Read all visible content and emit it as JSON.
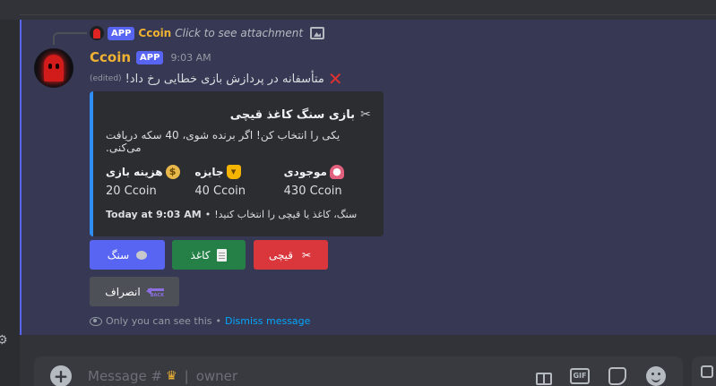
{
  "reply": {
    "app_badge": "APP",
    "username": "Ccoin",
    "text": "Click to see attachment"
  },
  "message": {
    "username": "Ccoin",
    "app_badge": "APP",
    "timestamp": "9:03 AM",
    "edited": "(edited)",
    "content": "متأسفانه در پردازش بازی خطایی رخ داد!"
  },
  "embed": {
    "accent_color": "#2f8ef4",
    "title": "بازی سنگ کاغذ قیچی",
    "description": "یکی را انتخاب کن! اگر برنده شوی، 40 سکه دریافت می‌کنی.",
    "fields": [
      {
        "name": "هزینه بازی",
        "value": "20 Ccoin",
        "icon": "money-bag-icon"
      },
      {
        "name": "جایزه",
        "value": "40 Ccoin",
        "icon": "trophy-icon"
      },
      {
        "name": "موجودی",
        "value": "430 Ccoin",
        "icon": "purse-icon"
      }
    ],
    "footer_time": "Today at 9:03 AM",
    "footer_text": "سنگ، کاغذ یا قیچی را انتخاب کنید!"
  },
  "buttons": {
    "rock": "سنگ",
    "paper": "کاغذ",
    "scissors": "قیچی",
    "cancel": "انصراف",
    "back_label": "BACK"
  },
  "ephemeral": {
    "text": "Only you can see this",
    "dismiss": "Dismiss message"
  },
  "composer": {
    "placeholder_prefix": "Message #",
    "placeholder_channel": "owner"
  },
  "colors": {
    "brand": "#5865f2",
    "success": "#248046",
    "danger": "#da373c",
    "secondary": "#4e5058",
    "username": "#f0b232",
    "link": "#00a8fc"
  }
}
